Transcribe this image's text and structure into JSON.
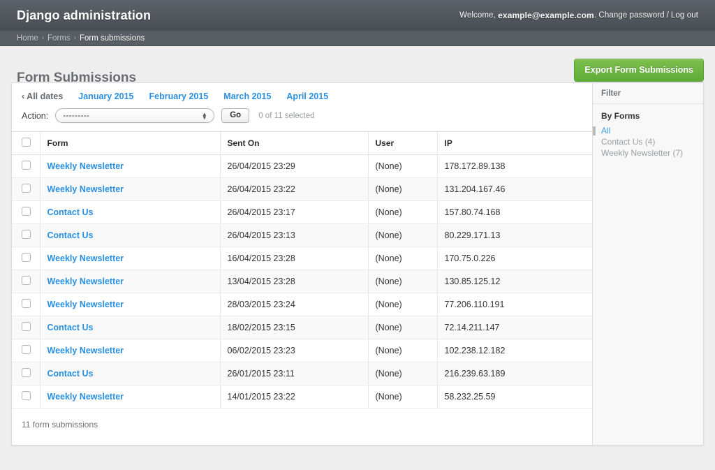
{
  "header": {
    "site_name": "Django administration",
    "welcome_prefix": "Welcome,",
    "username": "example@example.com",
    "welcome_suffix": ".",
    "change_password": "Change password",
    "separator": "/",
    "logout": "Log out"
  },
  "breadcrumbs": {
    "home": "Home",
    "forms": "Forms",
    "current": "Form submissions",
    "separator": "›"
  },
  "page": {
    "title": "Form Submissions",
    "export_button": "Export Form Submissions"
  },
  "date_hierarchy": {
    "all_dates": "All dates",
    "chevron": "‹",
    "months": [
      "January 2015",
      "February 2015",
      "March 2015",
      "April 2015"
    ]
  },
  "actions": {
    "label": "Action:",
    "selected_option": "---------",
    "options": [
      "---------"
    ],
    "go_button": "Go",
    "selection_note": "0 of 11 selected"
  },
  "table": {
    "columns": [
      "Form",
      "Sent On",
      "User",
      "IP"
    ],
    "rows": [
      {
        "form": "Weekly Newsletter",
        "sent_on": "26/04/2015 23:29",
        "user": "(None)",
        "ip": "178.172.89.138"
      },
      {
        "form": "Weekly Newsletter",
        "sent_on": "26/04/2015 23:22",
        "user": "(None)",
        "ip": "131.204.167.46"
      },
      {
        "form": "Contact Us",
        "sent_on": "26/04/2015 23:17",
        "user": "(None)",
        "ip": "157.80.74.168"
      },
      {
        "form": "Contact Us",
        "sent_on": "26/04/2015 23:13",
        "user": "(None)",
        "ip": "80.229.171.13"
      },
      {
        "form": "Weekly Newsletter",
        "sent_on": "16/04/2015 23:28",
        "user": "(None)",
        "ip": "170.75.0.226"
      },
      {
        "form": "Weekly Newsletter",
        "sent_on": "13/04/2015 23:28",
        "user": "(None)",
        "ip": "130.85.125.12"
      },
      {
        "form": "Weekly Newsletter",
        "sent_on": "28/03/2015 23:24",
        "user": "(None)",
        "ip": "77.206.110.191"
      },
      {
        "form": "Contact Us",
        "sent_on": "18/02/2015 23:15",
        "user": "(None)",
        "ip": "72.14.211.147"
      },
      {
        "form": "Weekly Newsletter",
        "sent_on": "06/02/2015 23:23",
        "user": "(None)",
        "ip": "102.238.12.182"
      },
      {
        "form": "Contact Us",
        "sent_on": "26/01/2015 23:11",
        "user": "(None)",
        "ip": "216.239.63.189"
      },
      {
        "form": "Weekly Newsletter",
        "sent_on": "14/01/2015 23:22",
        "user": "(None)",
        "ip": "58.232.25.59"
      }
    ],
    "result_count": "11 form submissions"
  },
  "filter": {
    "title": "Filter",
    "groups": [
      {
        "heading": "By Forms",
        "items": [
          {
            "label": "All",
            "selected": true
          },
          {
            "label": "Contact Us (4)",
            "selected": false
          },
          {
            "label": "Weekly Newsletter (7)",
            "selected": false
          }
        ]
      }
    ]
  },
  "colors": {
    "header_bg": "#52565d",
    "breadcrumb_bg": "#595d64",
    "link_blue": "#2b8fe0",
    "export_green": "#5ead37",
    "page_bg": "#eeeeee"
  }
}
